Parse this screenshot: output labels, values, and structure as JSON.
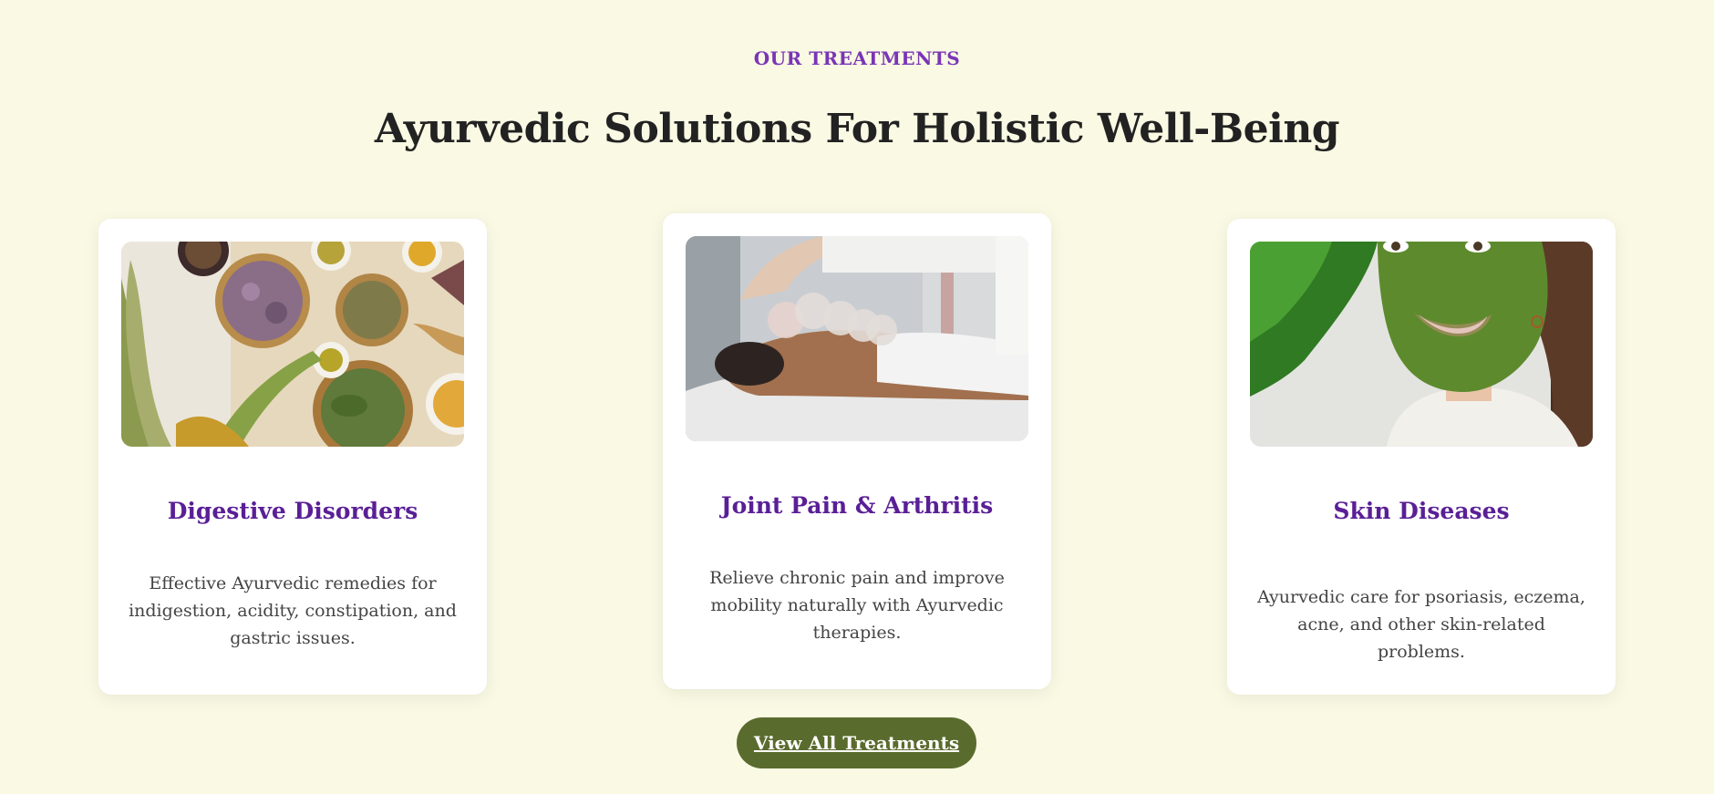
{
  "section": {
    "eyebrow": "OUR TREATMENTS",
    "heading": "Ayurvedic Solutions For Holistic Well-Being"
  },
  "cards": [
    {
      "image": "herbs-and-spices-photo",
      "title": "Digestive Disorders",
      "description": "Effective Ayurvedic remedies for indigestion, acidity, constipation, and gastric issues."
    },
    {
      "image": "cupping-therapy-photo",
      "title": "Joint Pain & Arthritis",
      "description": "Relieve chronic pain and improve mobility naturally with Ayurvedic therapies."
    },
    {
      "image": "herbal-face-mask-photo",
      "title": "Skin Diseases",
      "description": "Ayurvedic care for psoriasis, eczema, acne, and other skin-related problems."
    }
  ],
  "cta": {
    "label": "View All Treatments"
  },
  "colors": {
    "background": "#f9f9e4",
    "eyebrow": "#7a35b5",
    "card_title": "#5a1f96",
    "button": "#5a6b2e"
  }
}
